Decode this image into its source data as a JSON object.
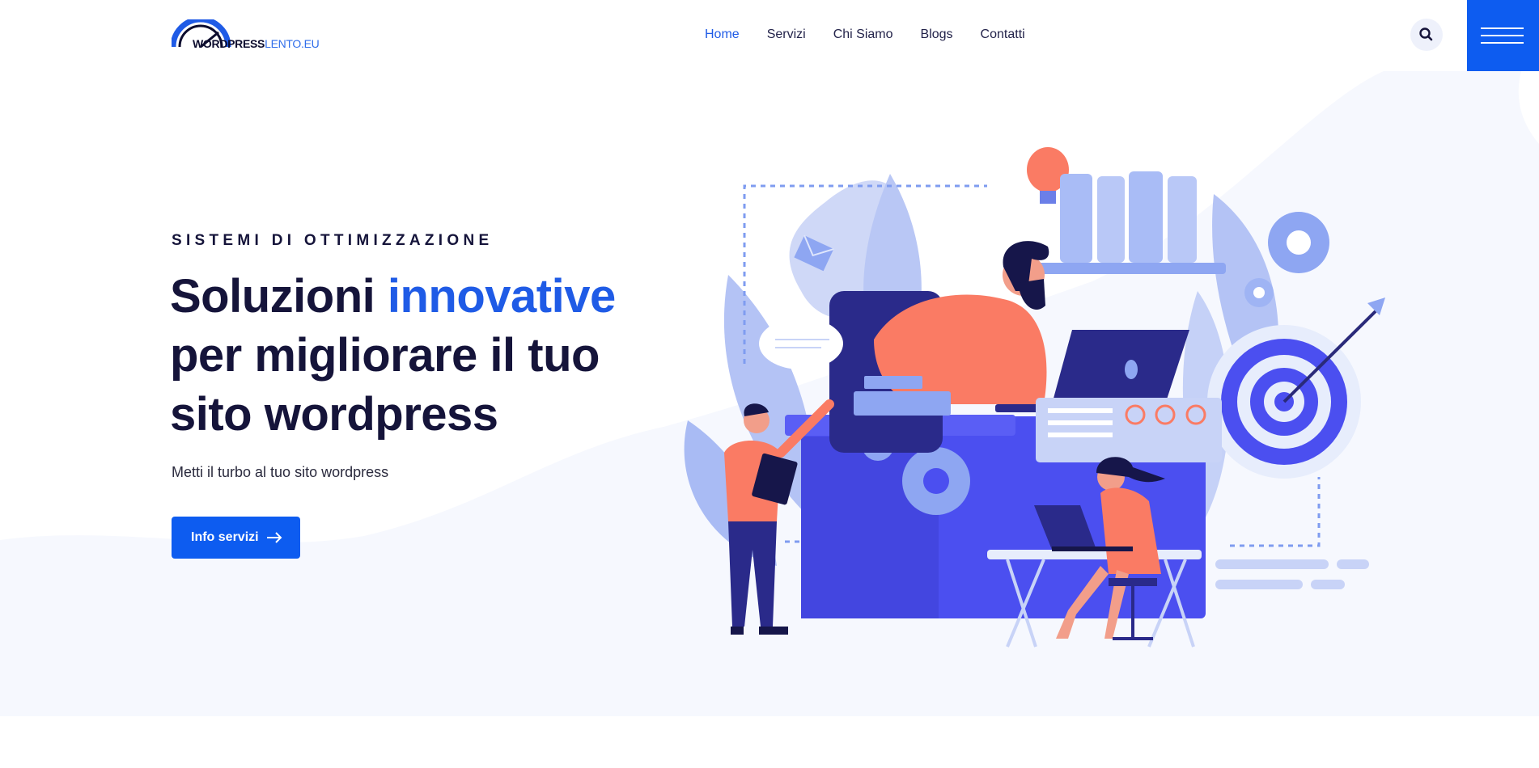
{
  "header": {
    "logo": {
      "strong": "WORDPRESS",
      "light": "LENTO.EU"
    },
    "nav": [
      "Home",
      "Servizi",
      "Chi Siamo",
      "Blogs",
      "Contatti"
    ],
    "active_nav": "Home",
    "search_icon": "search-icon",
    "menu_icon": "hamburger-menu-icon"
  },
  "hero": {
    "subtitle": "SISTEMI DI OTTIMIZZAZIONE",
    "headline_part1": "Soluzioni ",
    "headline_accent": "innovative",
    "headline_part2": "per migliorare il tuo",
    "headline_part3": "sito wordpress",
    "lead": "Metti il turbo al tuo sito wordpress",
    "cta_label": "Info servizi",
    "cta_icon": "arrow-right-icon"
  },
  "colors": {
    "accent": "#0d5cf0",
    "dark": "#15143a",
    "coral": "#fa7b64",
    "indigo": "#4b4ff0"
  }
}
